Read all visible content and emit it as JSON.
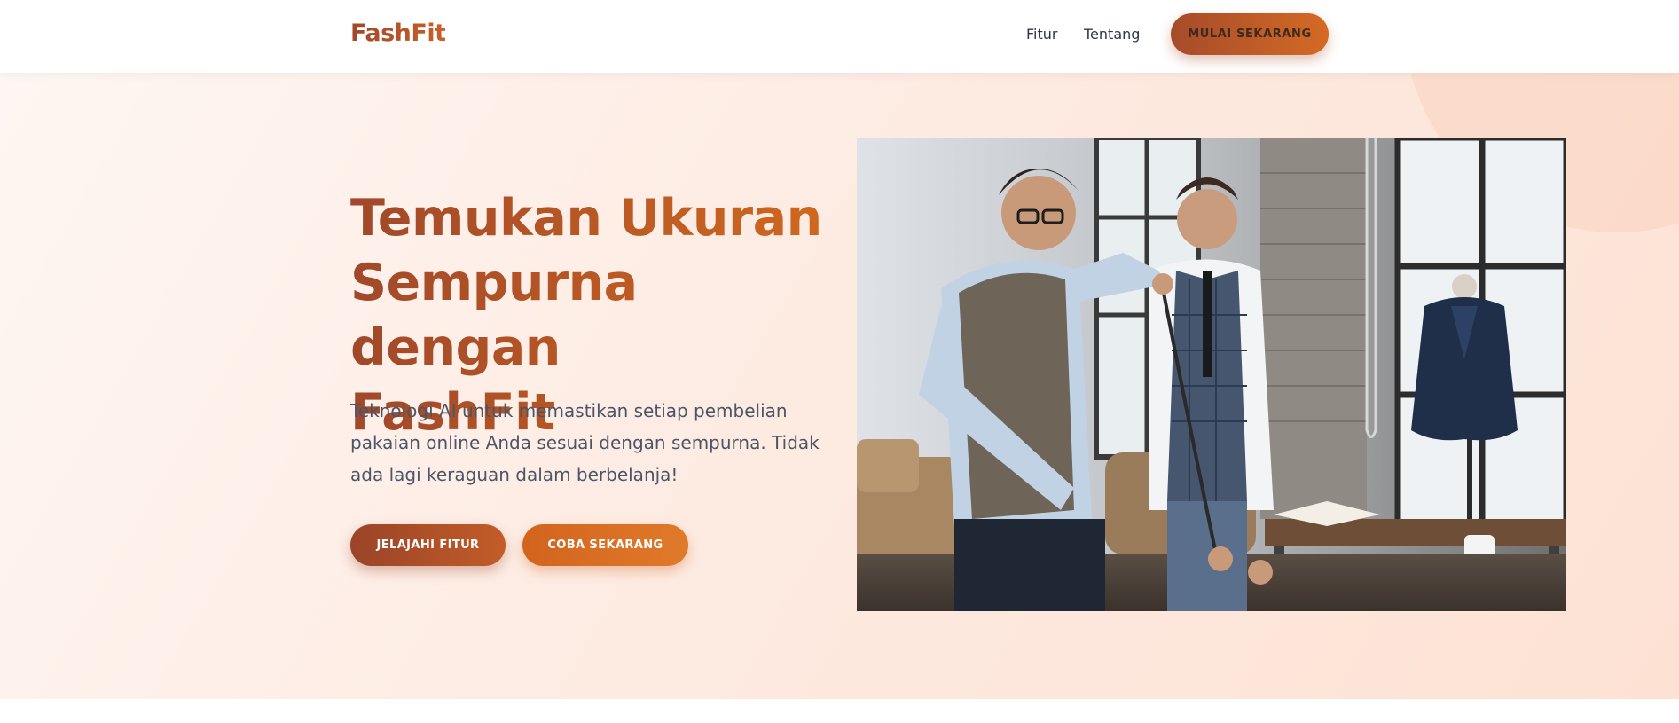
{
  "header": {
    "logo": "FashFit",
    "nav": [
      {
        "label": "Fitur"
      },
      {
        "label": "Tentang"
      }
    ],
    "cta_label": "MULAI SEKARANG"
  },
  "hero": {
    "title_lines": [
      "Temukan Ukuran",
      "Sempurna dengan",
      "FashFit"
    ],
    "description_lines": [
      "Teknologi AI untuk memastikan setiap pembelian",
      "pakaian online Anda sesuai dengan sempurna. Tidak",
      "ada lagi keraguan dalam berbelanja!"
    ],
    "buttons": {
      "explore_label": "JELAJAHI FITUR",
      "try_label": "COBA SEKARANG"
    },
    "image": {
      "subject": "tailor-measuring-client-photo"
    }
  },
  "colors": {
    "brand_dark": "#a0482a",
    "brand_light": "#d2691e",
    "text_body": "#4a5568",
    "hero_bg": "#fde9df"
  }
}
